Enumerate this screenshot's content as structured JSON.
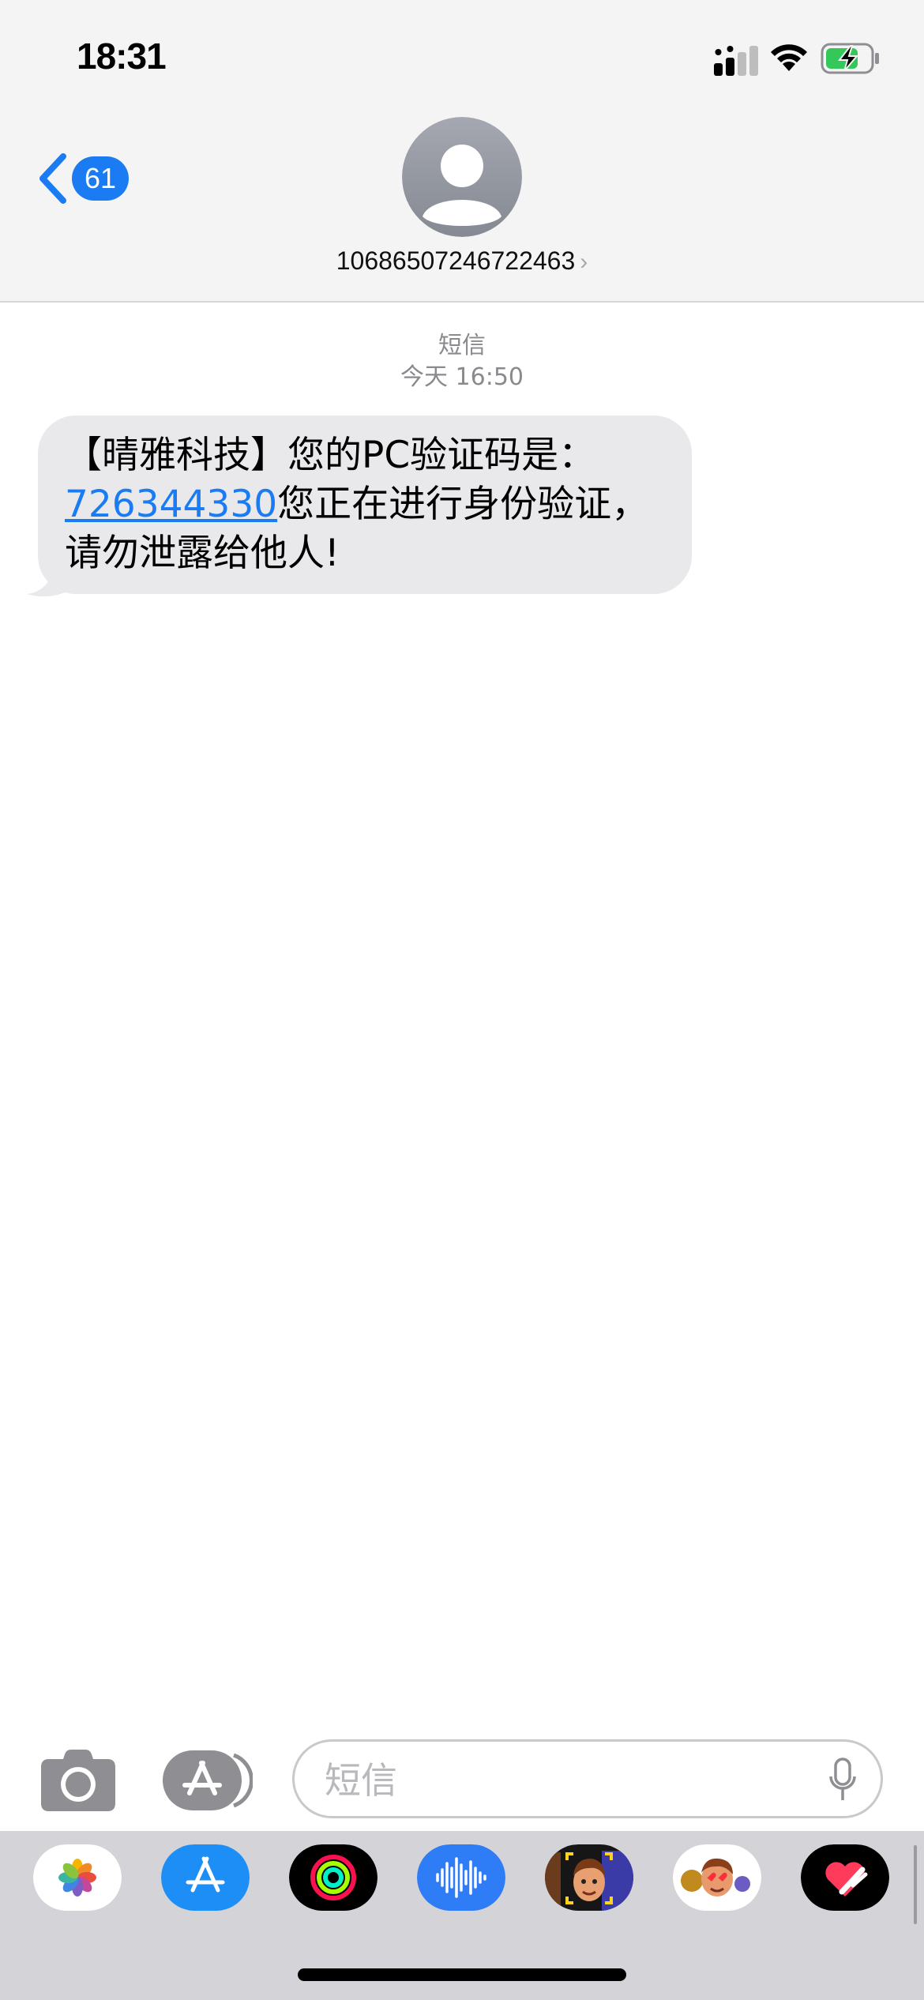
{
  "status_bar": {
    "time": "18:31"
  },
  "header": {
    "back_count": "61",
    "contact_number": "10686507246722463",
    "contact_chevron": "›"
  },
  "thread": {
    "service_label": "短信",
    "timestamp": "今天 16:50",
    "messages": [
      {
        "text_before": "【晴雅科技】您的PC验证码是：",
        "code": "726344330",
        "text_after": "您正在进行身份验证，请勿泄露给他人!"
      }
    ]
  },
  "composer": {
    "placeholder": "短信"
  },
  "drawer": {
    "apps": [
      "photos-app",
      "app-store-app",
      "activity-app",
      "audio-message-app",
      "memoji-app",
      "memoji-stickers-app",
      "digital-touch-app"
    ]
  },
  "colors": {
    "accent": "#1a7bf2",
    "header_bg": "#f4f4f4",
    "bubble_bg": "#e9e9eb",
    "drawer_bg": "#d3d3d8"
  }
}
